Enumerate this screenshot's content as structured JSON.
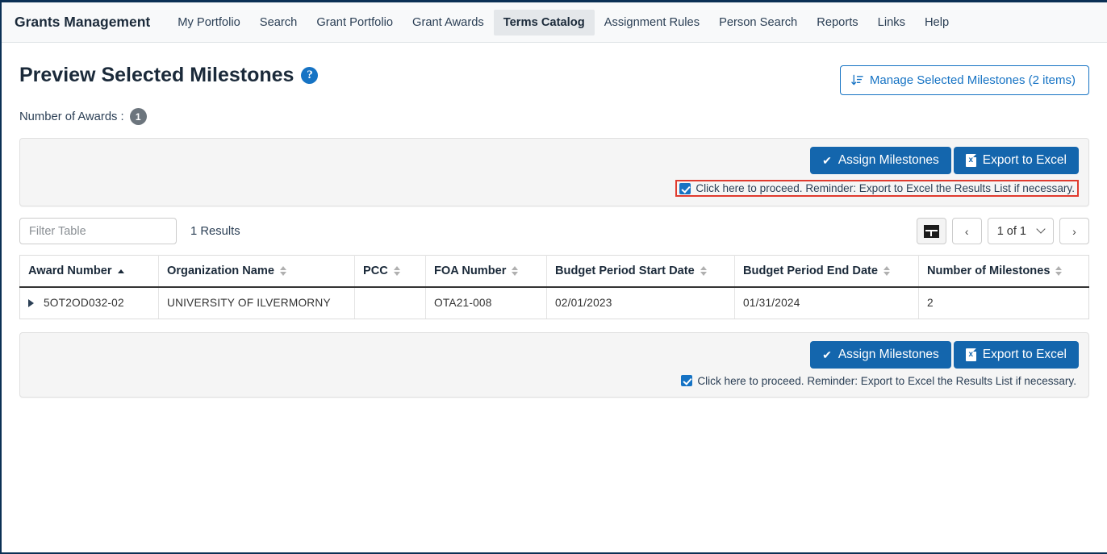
{
  "nav": {
    "brand": "Grants Management",
    "items": [
      {
        "label": "My Portfolio",
        "active": false
      },
      {
        "label": "Search",
        "active": false
      },
      {
        "label": "Grant Portfolio",
        "active": false
      },
      {
        "label": "Grant Awards",
        "active": false
      },
      {
        "label": "Terms Catalog",
        "active": true
      },
      {
        "label": "Assignment Rules",
        "active": false
      },
      {
        "label": "Person Search",
        "active": false
      },
      {
        "label": "Reports",
        "active": false
      },
      {
        "label": "Links",
        "active": false
      },
      {
        "label": "Help",
        "active": false
      }
    ]
  },
  "header": {
    "title": "Preview Selected Milestones",
    "help_icon": "question-circle-icon",
    "manage_button": {
      "label": "Manage Selected Milestones (2 items)",
      "icon": "sort-descending-icon"
    },
    "awards_label": "Number of Awards :",
    "awards_count": "1"
  },
  "actions": {
    "assign_label": "Assign Milestones",
    "assign_icon": "check-icon",
    "export_label": "Export to Excel",
    "export_icon": "excel-file-icon",
    "proceed_text": "Click here to proceed. Reminder: Export to Excel the Results List if necessary.",
    "proceed_checked": true,
    "highlight_color": "#e03b2f",
    "primary_color": "#1466ad"
  },
  "toolbar": {
    "filter_placeholder": "Filter Table",
    "filter_value": "",
    "results_text": "1 Results",
    "grid_view_icon": "grid-view-icon",
    "prev_label": "‹",
    "next_label": "›",
    "page_label": "1 of 1"
  },
  "table": {
    "columns": [
      {
        "label": "Award Number",
        "sort": "asc"
      },
      {
        "label": "Organization Name",
        "sort": "none"
      },
      {
        "label": "PCC",
        "sort": "none"
      },
      {
        "label": "FOA Number",
        "sort": "none"
      },
      {
        "label": "Budget Period Start Date",
        "sort": "none"
      },
      {
        "label": "Budget Period End Date",
        "sort": "none"
      },
      {
        "label": "Number of Milestones",
        "sort": "none"
      }
    ],
    "rows": [
      {
        "award_number": "5OT2OD032-02",
        "organization_name": "UNIVERSITY OF ILVERMORNY",
        "pcc": "",
        "foa_number": "OTA21-008",
        "budget_start": "02/01/2023",
        "budget_end": "01/31/2024",
        "milestones": "2"
      }
    ]
  }
}
